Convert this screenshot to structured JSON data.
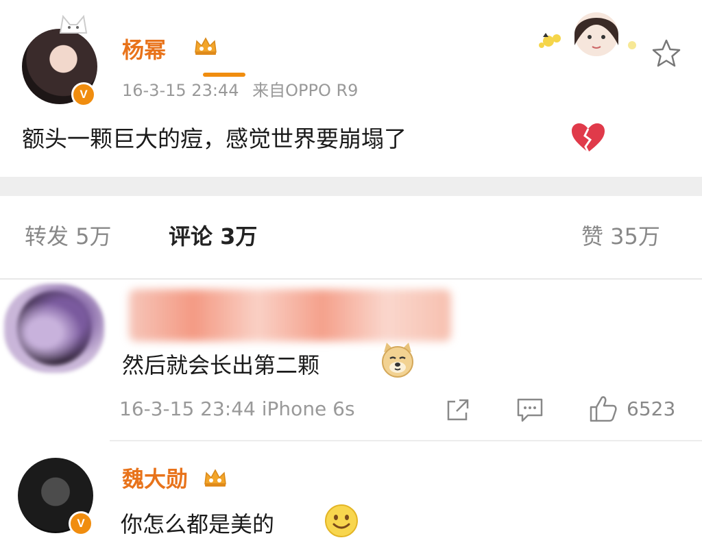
{
  "post": {
    "username": "杨幂",
    "timestamp": "16-3-15 23:44",
    "source": "来自OPPO R9",
    "text": "额头一颗巨大的痘，感觉世界要崩塌了",
    "verified_badge": "V",
    "emoji": "broken-heart-icon"
  },
  "tabs": {
    "repost": "转发 5万",
    "comments": "评论 3万",
    "likes": "赞 35万"
  },
  "comments": [
    {
      "username": "",
      "text": "然后就会长出第二颗",
      "emoji": "doge-icon",
      "timestamp": "16-3-15 23:44 iPhone 6s",
      "like_count": "6523"
    },
    {
      "username": "魏大勋",
      "text": "你怎么都是美的",
      "emoji": "smile-icon",
      "verified_badge": "V"
    }
  ],
  "colors": {
    "accent": "#e8731b",
    "badge": "#f08d0f",
    "meta": "#999999",
    "band": "#eeeeee"
  }
}
